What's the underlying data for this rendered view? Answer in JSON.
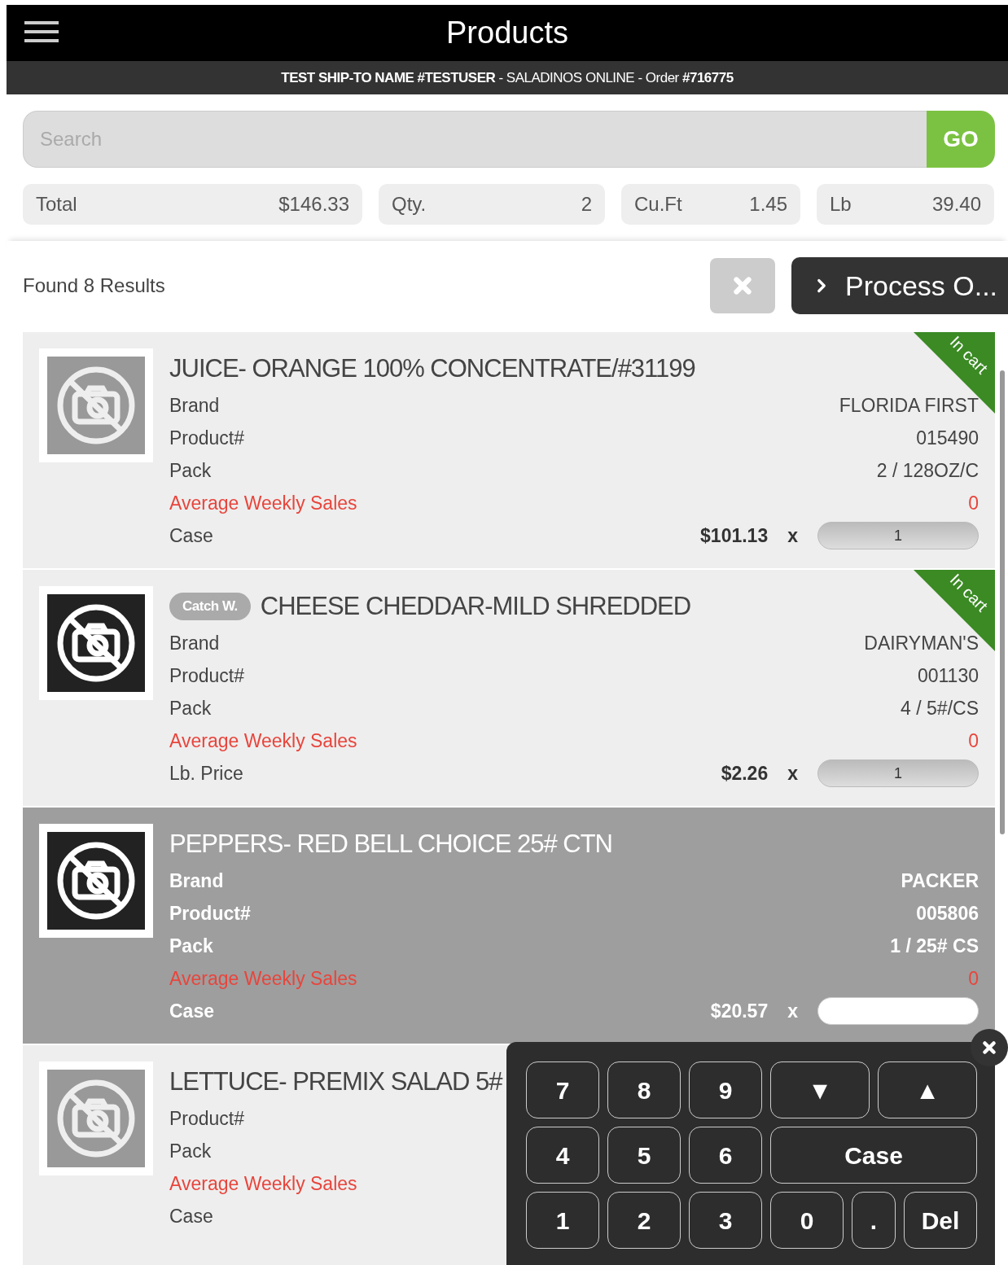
{
  "header": {
    "title": "Products",
    "subtitle": "**TEST  SHIP-TO NAME #TESTUSER** - SALADINOS ONLINE - Order **#716775**"
  },
  "search": {
    "placeholder": "Search",
    "button": "GO"
  },
  "totals": [
    {
      "label": "Total",
      "value": "$146.33"
    },
    {
      "label": "Qty.",
      "value": "2"
    },
    {
      "label": "Cu.Ft",
      "value": "1.45"
    },
    {
      "label": "Lb",
      "value": "39.40"
    }
  ],
  "results": {
    "count": "Found 8 Results",
    "process_button": "Process O..."
  },
  "products": [
    {
      "title": "JUICE- ORANGE 100% CONCENTRATE/#31199",
      "kind": "light",
      "selected": false,
      "in_cart": true,
      "in_cart_label": "In cart",
      "rows": [
        {
          "kind": "plain",
          "label": "Brand",
          "value": "FLORIDA FIRST"
        },
        {
          "kind": "plain",
          "label": "Product#",
          "value": "015490"
        },
        {
          "kind": "plain",
          "label": "Pack",
          "value": "2 / 128OZ/C"
        },
        {
          "kind": "alert",
          "label": "Average Weekly Sales",
          "value": "0"
        }
      ],
      "price_label": "Case",
      "price": "$101.13",
      "times": "x",
      "quantity": "1"
    },
    {
      "title": "CHEESE CHEDDAR-MILD SHREDDED",
      "badge": "Catch W.",
      "kind": "dark",
      "selected": false,
      "in_cart": true,
      "in_cart_label": "In cart",
      "rows": [
        {
          "kind": "plain",
          "label": "Brand",
          "value": "DAIRYMAN'S"
        },
        {
          "kind": "plain",
          "label": "Product#",
          "value": "001130"
        },
        {
          "kind": "plain",
          "label": "Pack",
          "value": "4 / 5#/CS"
        },
        {
          "kind": "alert",
          "label": "Average Weekly Sales",
          "value": "0"
        }
      ],
      "price_label": "Lb. Price",
      "price": "$2.26",
      "times": "x",
      "quantity": "1"
    },
    {
      "title": "PEPPERS- RED BELL CHOICE 25# CTN",
      "kind": "dark",
      "selected": true,
      "in_cart": false,
      "rows": [
        {
          "kind": "plain",
          "label": "Brand",
          "value": "PACKER"
        },
        {
          "kind": "plain",
          "label": "Product#",
          "value": "005806"
        },
        {
          "kind": "plain",
          "label": "Pack",
          "value": "1 / 25# CS"
        },
        {
          "kind": "alert",
          "label": "Average Weekly Sales",
          "value": "0"
        }
      ],
      "price_label": "Case",
      "price": "$20.57",
      "times": "x"
    },
    {
      "title": "LETTUCE- PREMIX SALAD 5#",
      "kind": "light",
      "selected": false,
      "in_cart": false,
      "rows": [
        {
          "kind": "plain",
          "label": "Product#"
        },
        {
          "kind": "plain",
          "label": "Pack"
        },
        {
          "kind": "alert",
          "label": "Average Weekly Sales"
        }
      ],
      "price_label": "Case"
    }
  ],
  "keypad": {
    "keys": [
      {
        "label": "7",
        "kind": "key"
      },
      {
        "label": "8",
        "kind": "key"
      },
      {
        "label": "9",
        "kind": "key"
      },
      {
        "label": "▼",
        "kind": "arrow"
      },
      {
        "label": "▲",
        "kind": "arrow"
      },
      {
        "label": "4",
        "kind": "key"
      },
      {
        "label": "5",
        "kind": "key"
      },
      {
        "label": "6",
        "kind": "key"
      },
      {
        "label": "Case",
        "kind": "wide"
      },
      {
        "label": "1",
        "kind": "key"
      },
      {
        "label": "2",
        "kind": "key"
      },
      {
        "label": "3",
        "kind": "key"
      },
      {
        "label": "0",
        "kind": "key"
      },
      {
        "label": ".",
        "kind": "small"
      },
      {
        "label": "Del",
        "kind": "del"
      }
    ]
  }
}
